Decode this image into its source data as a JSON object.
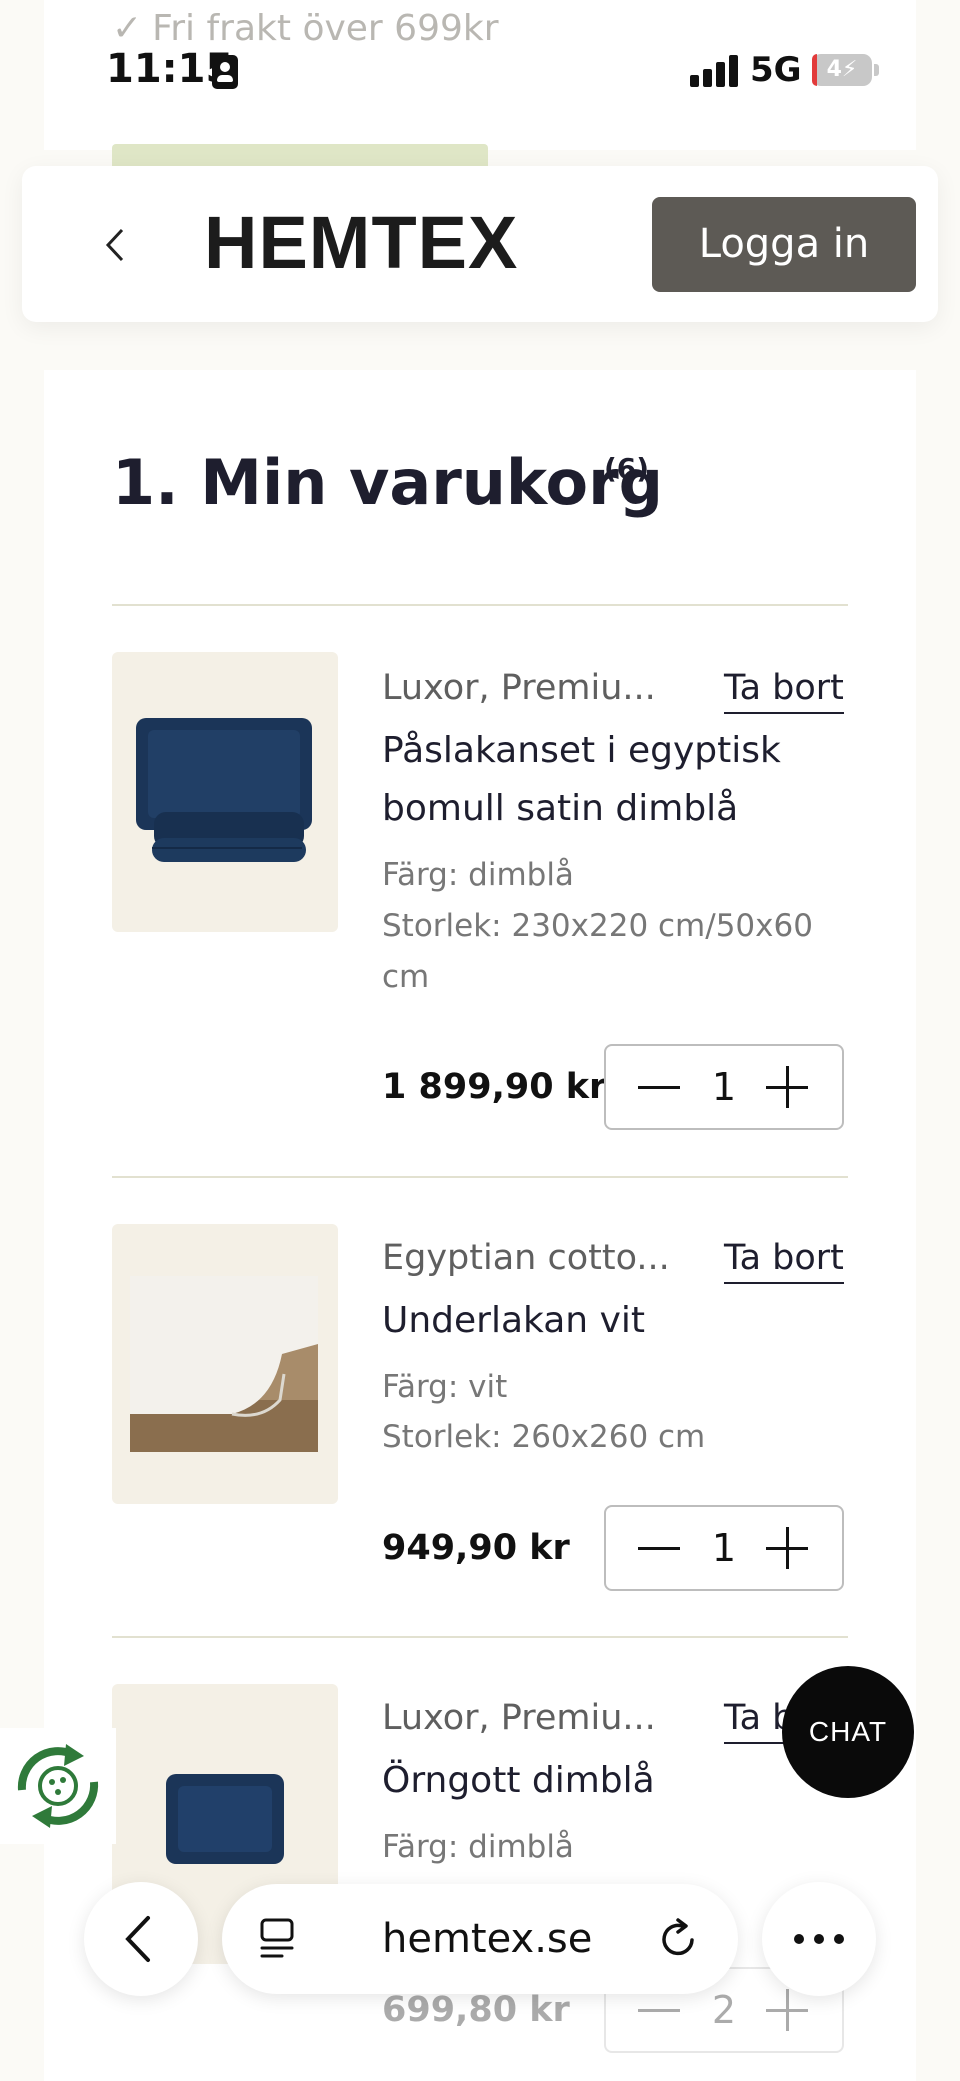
{
  "promo": {
    "text": "Fri frakt över 699kr"
  },
  "status_bar": {
    "time": "11:15",
    "network": "5G",
    "battery": "4",
    "battery_level_pct": 8
  },
  "header": {
    "logo": "HEMTEX",
    "login_label": "Logga in"
  },
  "cart": {
    "title": "1. Min varukorg",
    "count": "(6)",
    "remove_label": "Ta bort",
    "items": [
      {
        "brand": "Luxor, Premiu...",
        "name": "Påslakanset i egyptisk bomull satin dimblå",
        "color": "Färg: dimblå",
        "size": "Storlek: 230x220 cm/50x60 cm",
        "price": "1 899,90 kr",
        "qty": "1"
      },
      {
        "brand": "Egyptian cotto...",
        "name": "Underlakan vit",
        "color": "Färg: vit",
        "size": "Storlek: 260x260 cm",
        "price": "949,90 kr",
        "qty": "1"
      },
      {
        "brand": "Luxor, Premiu...",
        "remove_partial": "Ta b",
        "name": "Örngott dimblå",
        "color": "Färg: dimblå",
        "price": "699,80 kr",
        "qty": "2"
      }
    ]
  },
  "chat_label": "CHAT",
  "browser": {
    "url": "hemtex.se"
  },
  "colors": {
    "accent_button": "#5d5a55",
    "navy": "#1b3558",
    "chat": "#0a0a0a"
  }
}
